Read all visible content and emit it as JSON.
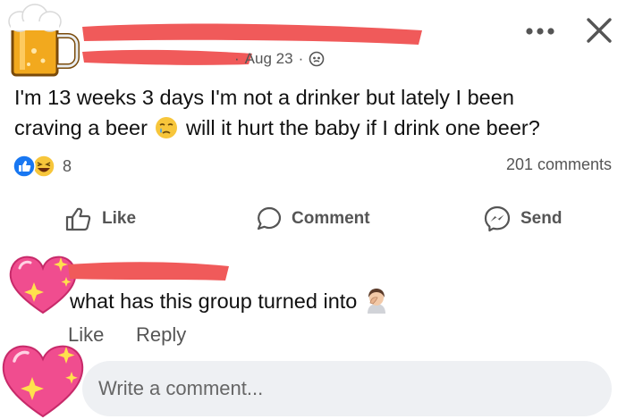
{
  "post": {
    "date": "Aug 23",
    "separator": "·",
    "body_line1": "I'm 13 weeks 3 days I'm not a drinker but lately I been",
    "body_line2a": "craving a beer",
    "body_line2b": "will it hurt the baby if I drink one beer?",
    "reaction_count": "8",
    "comments_count": "201 comments"
  },
  "actions": {
    "like": "Like",
    "comment": "Comment",
    "send": "Send"
  },
  "comment": {
    "text": "what has this group turned into",
    "like": "Like",
    "reply": "Reply"
  },
  "composer": {
    "placeholder": "Write a comment..."
  },
  "colors": {
    "redaction": "#f05a5a",
    "like_blue": "#1877f2",
    "haha_yellow": "#f7c63b",
    "heart_pink": "#f04d8f",
    "composer_bg": "#eef0f3"
  },
  "icons": {
    "avatar": "beer-mug-icon",
    "more": "more-dots-icon",
    "close": "close-icon",
    "audience": "globe-icon",
    "like": "thumbs-up-icon",
    "comment": "speech-bubble-icon",
    "send": "messenger-icon",
    "face": "crying-face-icon",
    "facepalm": "facepalm-icon",
    "commenter_avatar": "sparkling-heart-icon"
  }
}
